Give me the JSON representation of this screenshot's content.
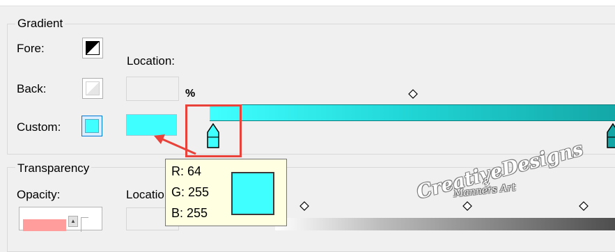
{
  "gradient_group": {
    "title": "Gradient",
    "fore_label": "Fore:",
    "back_label": "Back:",
    "custom_label": "Custom:",
    "location_label": "Location:",
    "percent_label": "%",
    "location_value": "",
    "custom_color": "#40ffff"
  },
  "transparency_group": {
    "title": "Transparency",
    "opacity_label": "Opacity:",
    "location_label": "Locatio",
    "opacity_color": "#ff9c9c"
  },
  "tooltip": {
    "r": "R: 64",
    "g": "G: 255",
    "b": "B: 255",
    "color": "#40ffff"
  },
  "watermark": {
    "line1": "CreativeDesigns",
    "amp": "&",
    "line2": "Manners Art"
  },
  "colors": {
    "highlight": "#e8423a",
    "gradient_start": "#40ffff",
    "gradient_end": "#14a6a6"
  }
}
